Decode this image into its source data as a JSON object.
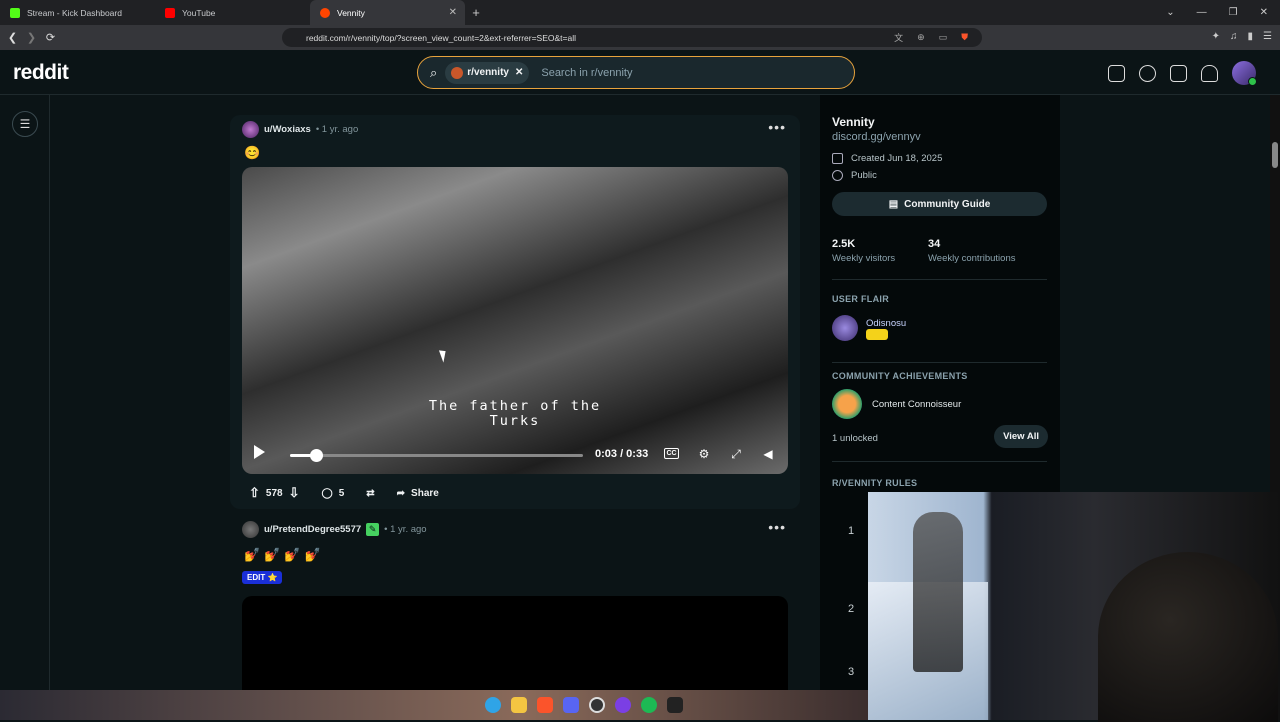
{
  "browser": {
    "tabs": [
      {
        "label": "Stream - Kick Dashboard",
        "color": "#53fc18"
      },
      {
        "label": "YouTube",
        "color": "#ff0000"
      },
      {
        "label": "Vennity",
        "color": "#ff4500"
      }
    ],
    "url": "reddit.com/r/vennity/top/?screen_view_count=2&ext-referrer=SEO&t=all"
  },
  "header": {
    "logo": "reddit",
    "search_chip": "r/vennity",
    "search_placeholder": "Search in r/vennity"
  },
  "posts": [
    {
      "user": "u/Woxiaxs",
      "age": "• 1 yr. ago",
      "body_emoji": "😊",
      "caption_line1": "The father of the",
      "caption_line2": "Turks",
      "time": "0:03 / 0:33",
      "progress": 0.09,
      "votes": "578",
      "comments": "5",
      "share": "Share"
    },
    {
      "user": "u/PretendDegree5577",
      "age": "• 1 yr. ago",
      "body_emoji": "💅💅💅💅",
      "edit_label": "EDIT ⭐"
    }
  ],
  "sidebar": {
    "name": "Vennity",
    "link": "discord.gg/vennyv",
    "created": "Created Jun 18, 2025",
    "visibility": "Public",
    "guide_button": "Community Guide",
    "stats": [
      {
        "value": "2.5K",
        "label": "Weekly visitors"
      },
      {
        "value": "34",
        "label": "Weekly contributions"
      }
    ],
    "user_flair_title": "USER FLAIR",
    "flair_user": "Odisnosu",
    "achievements_title": "COMMUNITY ACHIEVEMENTS",
    "achievement": "Content Connoisseur",
    "unlocked": "1 unlocked",
    "view_all": "View All",
    "rules_title": "R/VENNITY RULES",
    "rule_numbers": [
      "1",
      "2",
      "3"
    ]
  }
}
